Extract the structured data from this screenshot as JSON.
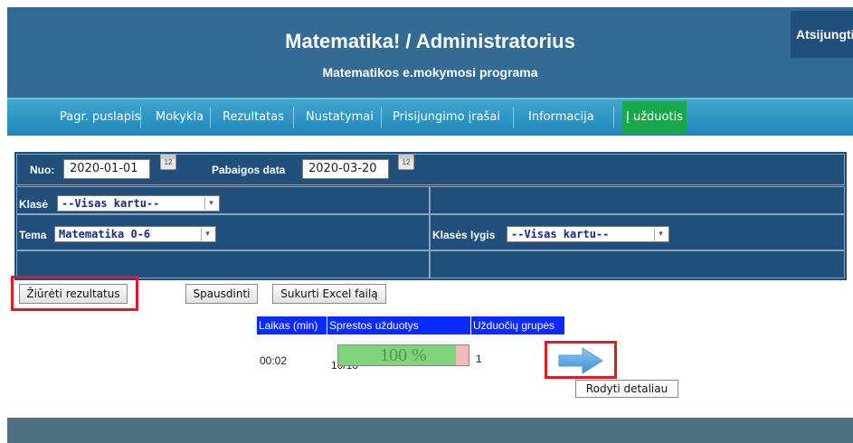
{
  "header": {
    "title": "Matematika! / Administratorius",
    "subtitle": "Matematikos e.mokymosi programa",
    "logout_label": "Atsijungti"
  },
  "nav": {
    "items": [
      {
        "label": "Pagr. puslapis"
      },
      {
        "label": "Mokykla"
      },
      {
        "label": "Rezultatas"
      },
      {
        "label": "Nustatymai"
      },
      {
        "label": "Prisijungimo įrašai"
      },
      {
        "label": "Informacija"
      },
      {
        "label": "Į užduotis"
      }
    ],
    "active_color": "#16a84a"
  },
  "filters": {
    "from_label": "Nuo:",
    "from_value": "2020-01-01",
    "to_label": "Pabaigos data",
    "to_value": "2020-03-20",
    "calendar_icon_text": "12",
    "class_label": "Klasė",
    "class_value": "--Visas kartu--",
    "topic_label": "Tema",
    "topic_value": "Matematika 0-6",
    "level_label": "Klasės lygis",
    "level_value": "--Visas kartu--"
  },
  "actions": {
    "view_results": "Žiūrėti rezultatus",
    "print": "Spausdinti",
    "excel": "Sukurti Excel failą"
  },
  "results": {
    "headers": [
      "Laikas (min)",
      "Sprestos užduotys",
      "Užduočių grupės"
    ],
    "time": "00:02",
    "solved": "10/10",
    "percent_label": "100 %",
    "percent_value": 1.0,
    "groups": "1",
    "tooltip": "Rodyti detaliau"
  },
  "colors": {
    "header_bg": "#336b95",
    "panel_bg": "#1f4f7a",
    "highlight_red": "#e01b24",
    "result_header_bg": "#0a2aff"
  }
}
